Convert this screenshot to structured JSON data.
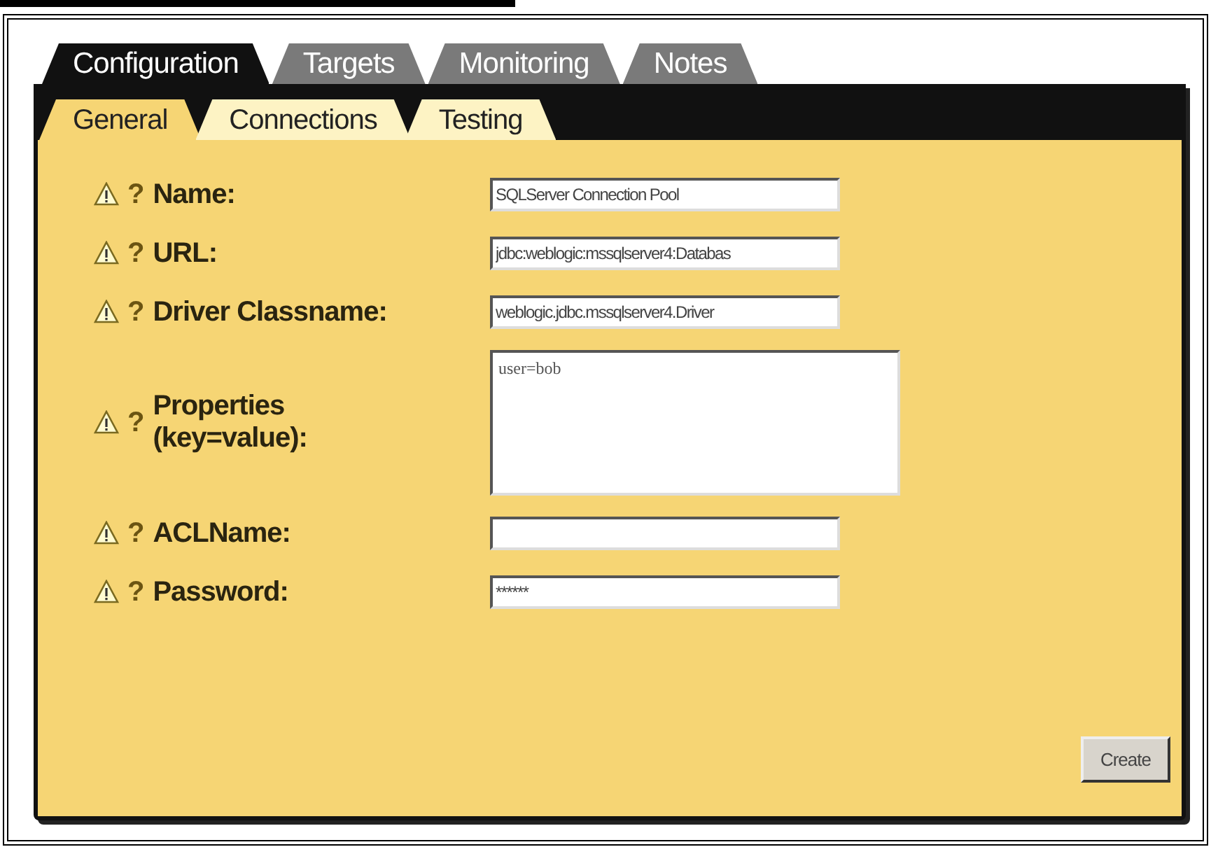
{
  "tabs": [
    {
      "label": "Configuration",
      "selected": true
    },
    {
      "label": "Targets",
      "selected": false
    },
    {
      "label": "Monitoring",
      "selected": false
    },
    {
      "label": "Notes",
      "selected": false
    }
  ],
  "subtabs": [
    {
      "label": "General",
      "selected": true
    },
    {
      "label": "Connections",
      "selected": false
    },
    {
      "label": "Testing",
      "selected": false
    }
  ],
  "fields": [
    {
      "kind": "text",
      "help": "?",
      "label": "Name:",
      "value": "SQLServer Connection Pool"
    },
    {
      "kind": "text",
      "help": "?",
      "label": "URL:",
      "value": "jdbc:weblogic:mssqlserver4:Databas"
    },
    {
      "kind": "text",
      "help": "?",
      "label": "Driver Classname:",
      "value": "weblogic.jdbc.mssqlserver4.Driver"
    },
    {
      "kind": "textarea",
      "help": "?",
      "label": "Properties (key=value):",
      "value": "user=bob"
    },
    {
      "kind": "text",
      "help": "?",
      "label": "ACLName:"
    },
    {
      "kind": "text",
      "help": "?",
      "label": "Password:",
      "value": "******"
    }
  ],
  "buttons": [
    "Create"
  ]
}
